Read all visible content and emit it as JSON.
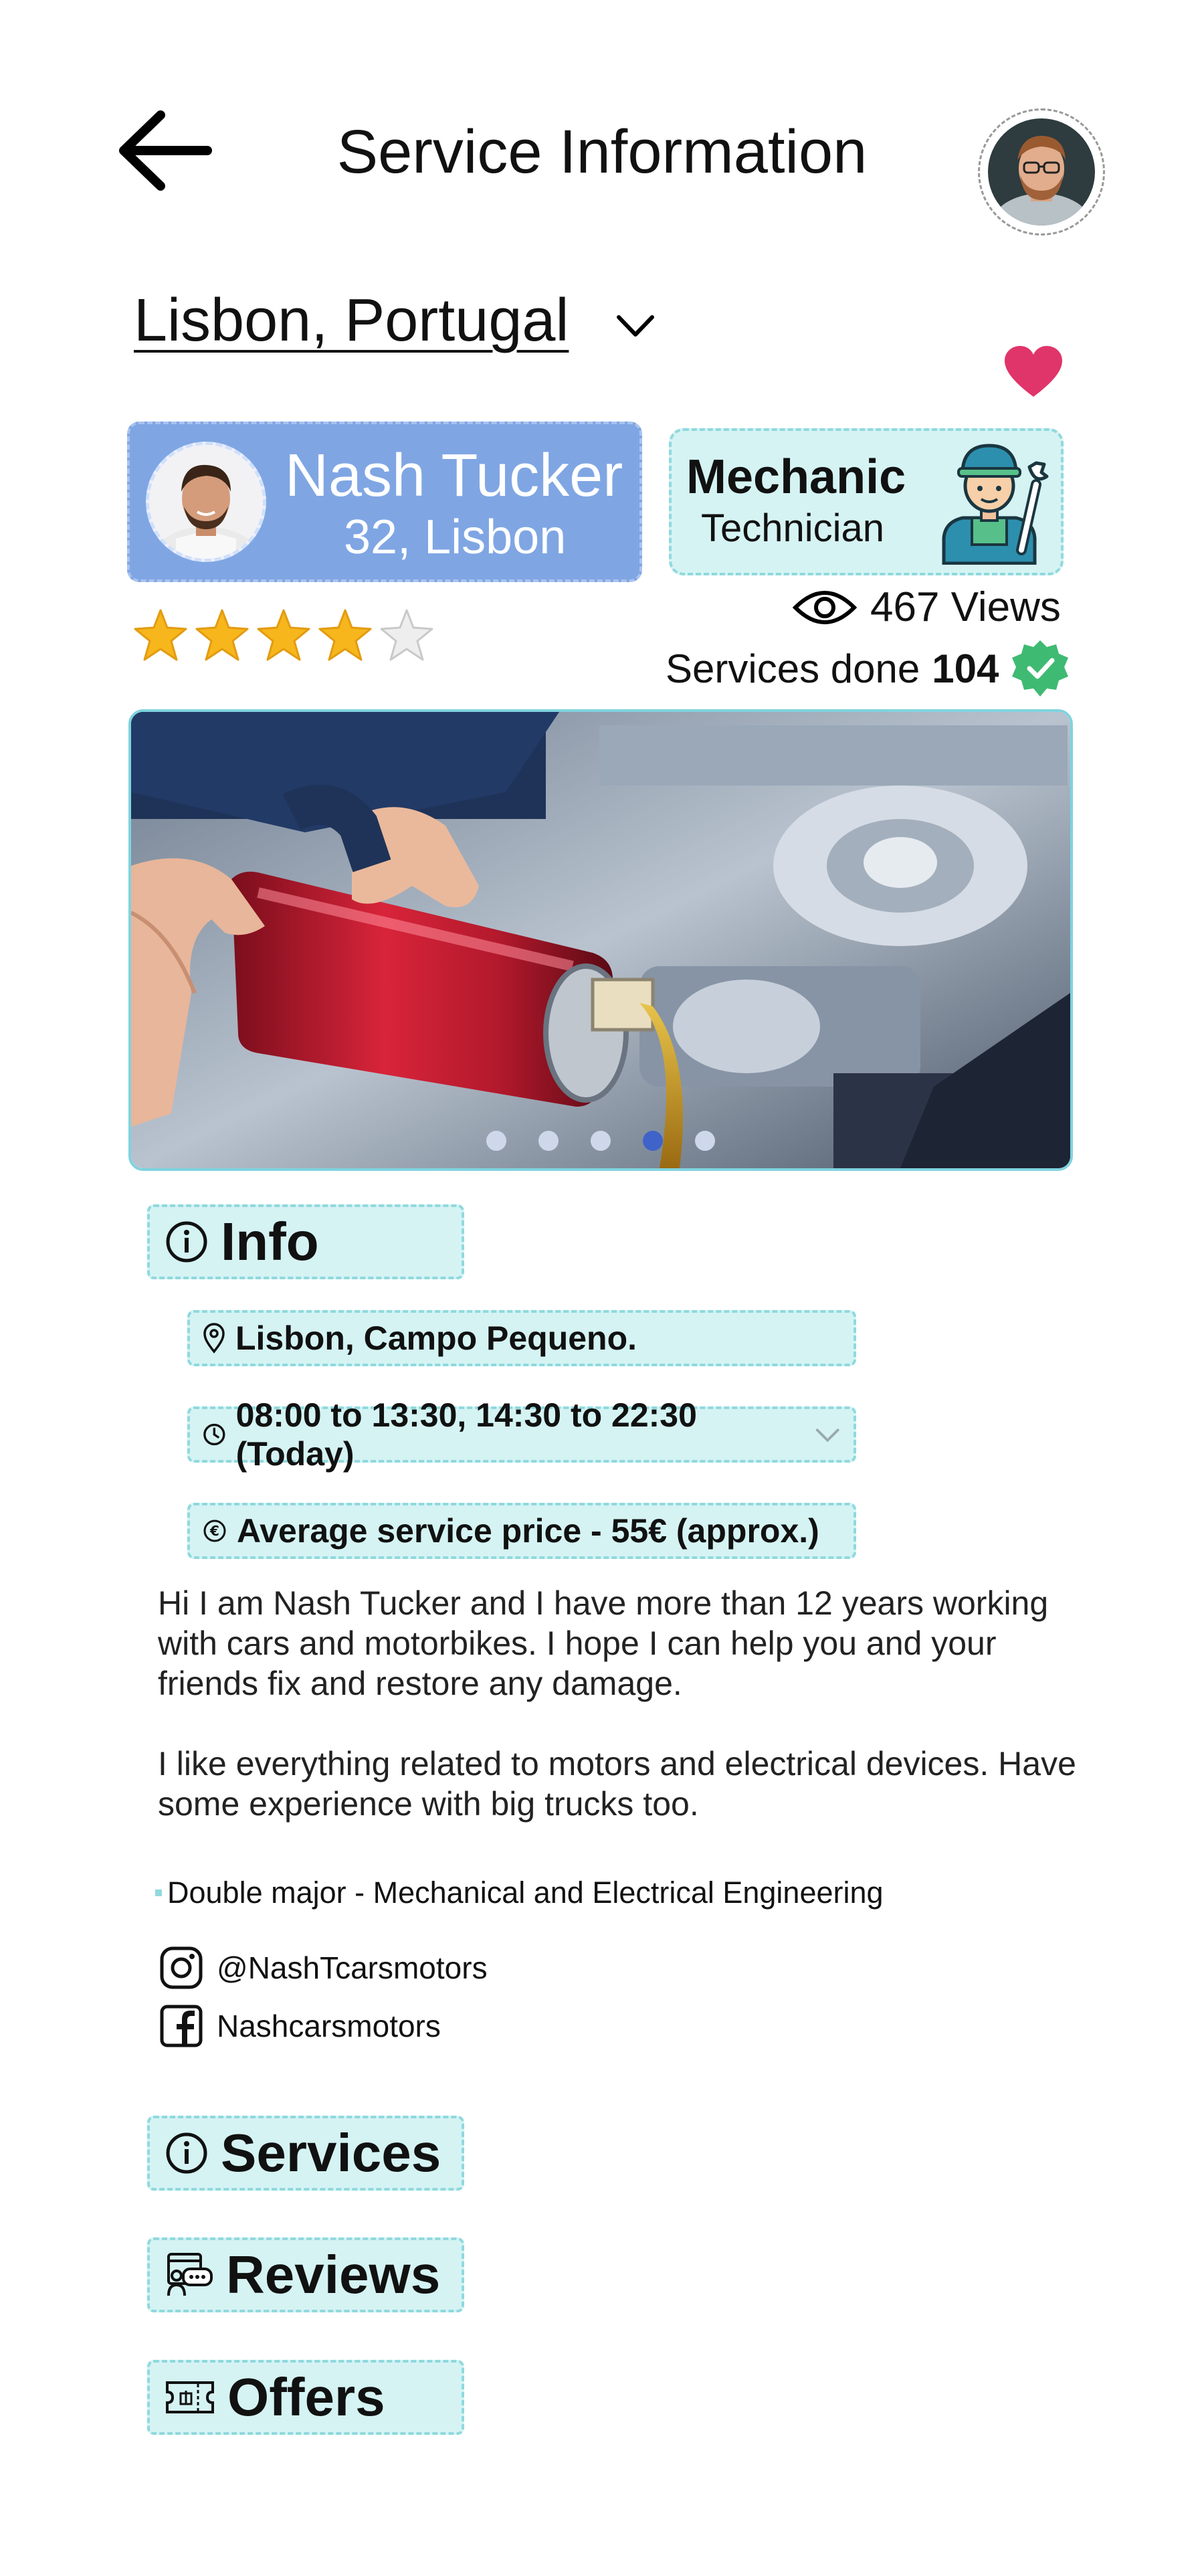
{
  "header": {
    "title": "Service Information",
    "back_icon": "arrow-left-icon",
    "avatar_icon": "user-avatar"
  },
  "location": {
    "label": "Lisbon, Portugal",
    "dropdown_icon": "chevron-down-icon"
  },
  "favorite": {
    "icon": "heart-icon",
    "color": "#e0356a"
  },
  "profile": {
    "name": "Nash Tucker",
    "subtitle": "32, Lisbon",
    "card_color": "#7fa6e3"
  },
  "role": {
    "title": "Mechanic",
    "subtitle": "Technician",
    "icon": "mechanic-icon"
  },
  "rating": {
    "value": 4,
    "max": 5,
    "star_color": "#f6b61c"
  },
  "stats": {
    "views_text": "467 Views",
    "services_label": "Services done",
    "services_count": "104",
    "verified_icon": "verified-badge-icon"
  },
  "carousel": {
    "slide_count": 5,
    "active_index": 3
  },
  "sections": {
    "info": "Info",
    "services": "Services",
    "reviews": "Reviews",
    "offers": "Offers"
  },
  "info": {
    "address": "Lisbon, Campo Pequeno.",
    "hours": "08:00 to 13:30, 14:30 to 22:30 (Today)",
    "price": "Average service price - 55€ (approx.)"
  },
  "bio": {
    "paragraph1": "Hi I am Nash Tucker and I have more than 12 years working with cars and motorbikes. I hope I can help you and your friends fix and restore any damage.",
    "paragraph2": "I like everything related to motors and electrical devices. Have some experience with big trucks too.",
    "degree": "Double major - Mechanical and Electrical Engineering"
  },
  "social": {
    "instagram": "@NashTcarsmotors",
    "facebook": "Nashcarsmotors"
  },
  "colors": {
    "accent_box": "#d5f3f3",
    "accent_border": "#8fd9de",
    "verified": "#3fba72"
  }
}
